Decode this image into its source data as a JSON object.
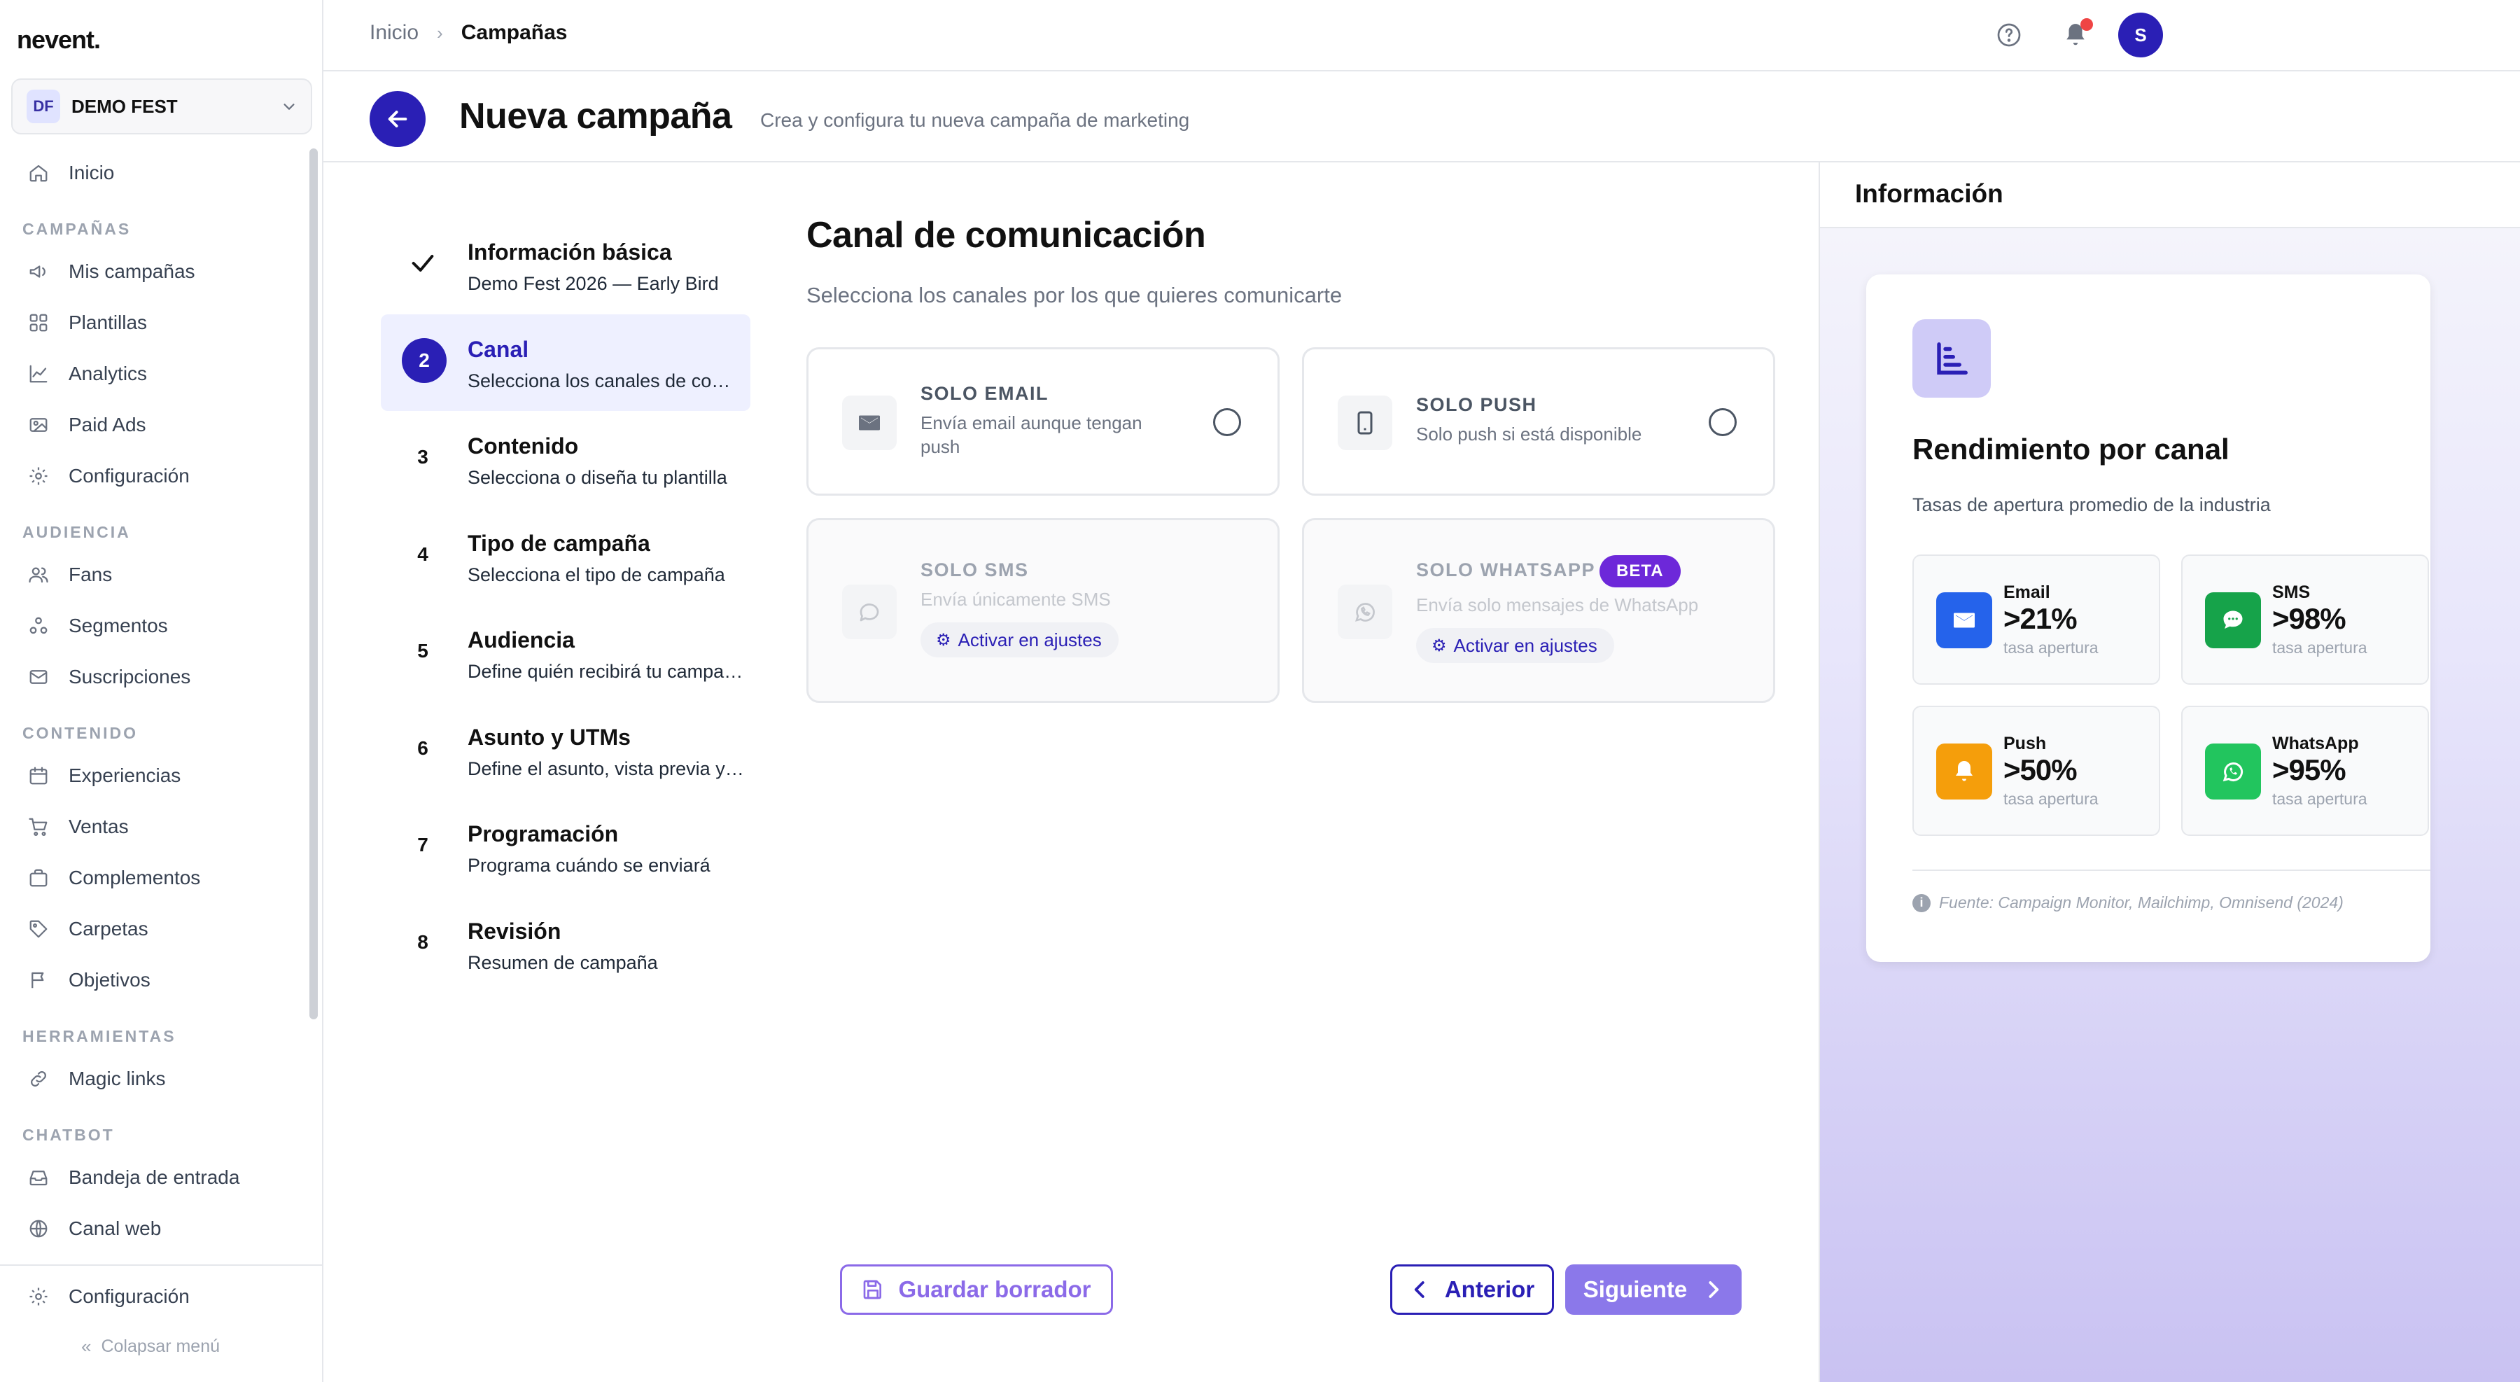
{
  "app": {
    "logo": "nevent."
  },
  "org": {
    "initials": "DF",
    "name": "DEMO FEST"
  },
  "sidebar": {
    "inicio": "Inicio",
    "sections": {
      "campanas": "CAMPAÑAS",
      "audiencia": "AUDIENCIA",
      "contenido": "CONTENIDO",
      "herramientas": "HERRAMIENTAS",
      "chatbot": "CHATBOT"
    },
    "items": {
      "mis_campanas": "Mis campañas",
      "plantillas": "Plantillas",
      "analytics": "Analytics",
      "paid_ads": "Paid Ads",
      "configuracion": "Configuración",
      "fans": "Fans",
      "segmentos": "Segmentos",
      "suscripciones": "Suscripciones",
      "experiencias": "Experiencias",
      "ventas": "Ventas",
      "complementos": "Complementos",
      "carpetas": "Carpetas",
      "objetivos": "Objetivos",
      "magic_links": "Magic links",
      "bandeja": "Bandeja de entrada",
      "canal_web": "Canal web"
    },
    "footer_config": "Configuración",
    "collapse": "Colapsar menú"
  },
  "topbar": {
    "breadcrumb_home": "Inicio",
    "breadcrumb_current": "Campañas",
    "avatar_initial": "S"
  },
  "page": {
    "title": "Nueva campaña",
    "subtitle": "Crea y configura tu nueva campaña de marketing"
  },
  "steps": [
    {
      "num": "",
      "title": "Información básica",
      "desc": "Demo Fest 2026 — Early Bird"
    },
    {
      "num": "2",
      "title": "Canal",
      "desc": "Selecciona los canales de comunicación"
    },
    {
      "num": "3",
      "title": "Contenido",
      "desc": "Selecciona o diseña tu plantilla"
    },
    {
      "num": "4",
      "title": "Tipo de campaña",
      "desc": "Selecciona el tipo de campaña"
    },
    {
      "num": "5",
      "title": "Audiencia",
      "desc": "Define quién recibirá tu campaña"
    },
    {
      "num": "6",
      "title": "Asunto y UTMs",
      "desc": "Define el asunto, vista previa y UTMs"
    },
    {
      "num": "7",
      "title": "Programación",
      "desc": "Programa cuándo se enviará"
    },
    {
      "num": "8",
      "title": "Revisión",
      "desc": "Resumen de campaña"
    }
  ],
  "channel": {
    "title": "Canal de comunicación",
    "subtitle": "Selecciona los canales por los que quieres comunicarte",
    "email": {
      "name": "SOLO EMAIL",
      "desc_1": "Envía email aunque tengan",
      "desc_2": "push"
    },
    "push": {
      "name": "SOLO PUSH",
      "desc": "Solo push si está disponible"
    },
    "sms": {
      "name": "SOLO SMS",
      "desc": "Envía únicamente SMS",
      "action": "Activar en ajustes"
    },
    "whatsapp": {
      "name": "SOLO WHATSAPP",
      "badge": "BETA",
      "desc": "Envía solo mensajes de WhatsApp",
      "action": "Activar en ajustes"
    }
  },
  "actions": {
    "draft": "Guardar borrador",
    "prev": "Anterior",
    "next": "Siguiente"
  },
  "info": {
    "header": "Información",
    "perf_title": "Rendimiento por canal",
    "perf_sub": "Tasas de apertura promedio de la industria",
    "stats": [
      {
        "name": "Email",
        "value": ">21%",
        "label": "tasa apertura",
        "color": "#2563eb"
      },
      {
        "name": "SMS",
        "value": ">98%",
        "label": "tasa apertura",
        "color": "#16a34a"
      },
      {
        "name": "Push",
        "value": ">50%",
        "label": "tasa apertura",
        "color": "#f59e0b"
      },
      {
        "name": "WhatsApp",
        "value": ">95%",
        "label": "tasa apertura",
        "color": "#22c55e"
      }
    ],
    "source": "Fuente: Campaign Monitor, Mailchimp, Omnisend (2024)"
  },
  "colors": {
    "primary": "#2a1fb5",
    "accent": "#8b6ae8",
    "beta": "#6d28d9"
  }
}
